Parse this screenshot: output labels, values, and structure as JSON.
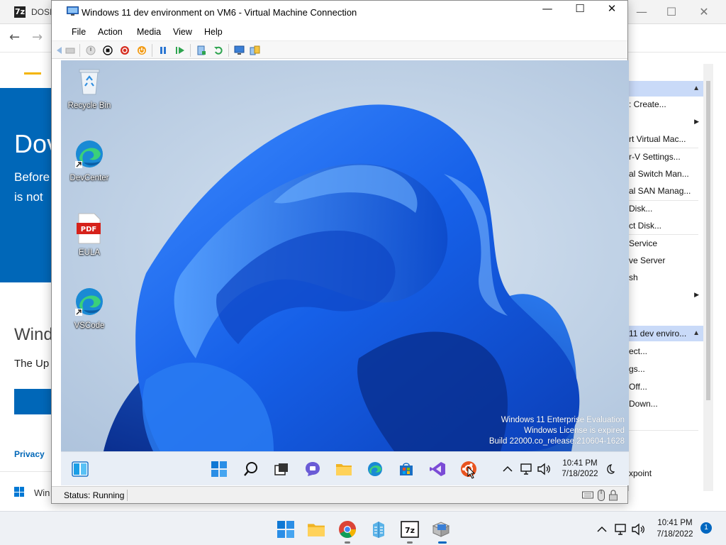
{
  "background_app": {
    "icon": "7z",
    "title": "DOSI",
    "minimize": "—",
    "maximize": "☐",
    "close": "✕",
    "nav_back": "←",
    "nav_forward": "→"
  },
  "background_page": {
    "hero_heading": "Dov",
    "hero_line1": "Before",
    "hero_line2": "is not",
    "section_title": "Wind",
    "section_text": "The Up",
    "privacy_link": "Privacy",
    "taskbar_label": "Win"
  },
  "actions_pane": {
    "header1": "",
    "items": [
      {
        "label": ": Create..."
      },
      {
        "label": "rt Virtual Mac..."
      },
      {
        "label": "r-V Settings..."
      },
      {
        "label": "al Switch Man..."
      },
      {
        "label": "al SAN Manag..."
      },
      {
        "label": "Disk..."
      },
      {
        "label": "ct Disk..."
      },
      {
        "label": "Service"
      },
      {
        "label": "ve Server"
      },
      {
        "label": "sh"
      }
    ],
    "header2": "11 dev enviro...",
    "vm_items": [
      {
        "label": "ect..."
      },
      {
        "label": "gs..."
      },
      {
        "label": "Off..."
      },
      {
        "label": "Down..."
      },
      {
        "label": "xpoint"
      }
    ]
  },
  "vm_window": {
    "title": "Windows 11 dev environment on VM6 - Virtual Machine Connection",
    "minimize": "—",
    "maximize": "☐",
    "close": "✕",
    "menu": [
      "File",
      "Action",
      "Media",
      "View",
      "Help"
    ],
    "status": "Status: Running"
  },
  "guest": {
    "desktop_icons": [
      {
        "label": "Recycle Bin",
        "icon": "recycle-bin-icon"
      },
      {
        "label": "DevCenter",
        "icon": "edge-icon"
      },
      {
        "label": "EULA",
        "icon": "pdf-icon",
        "badge": "PDF"
      },
      {
        "label": "VSCode",
        "icon": "edge-icon"
      }
    ],
    "watermark": {
      "line1": "Windows 11 Enterprise Evaluation",
      "line2": "Windows License is expired",
      "line3": "Build 22000.co_release.210604-1628"
    },
    "clock": {
      "time": "10:41 PM",
      "date": "7/18/2022"
    },
    "tray_chevron": "^"
  },
  "host": {
    "clock": {
      "time": "10:41 PM",
      "date": "7/18/2022"
    },
    "notification_count": "1",
    "tray_chevron": "^"
  },
  "colors": {
    "accent": "#0067b8",
    "bloom_blue": "#1565e6",
    "selection": "#c9daf8"
  }
}
